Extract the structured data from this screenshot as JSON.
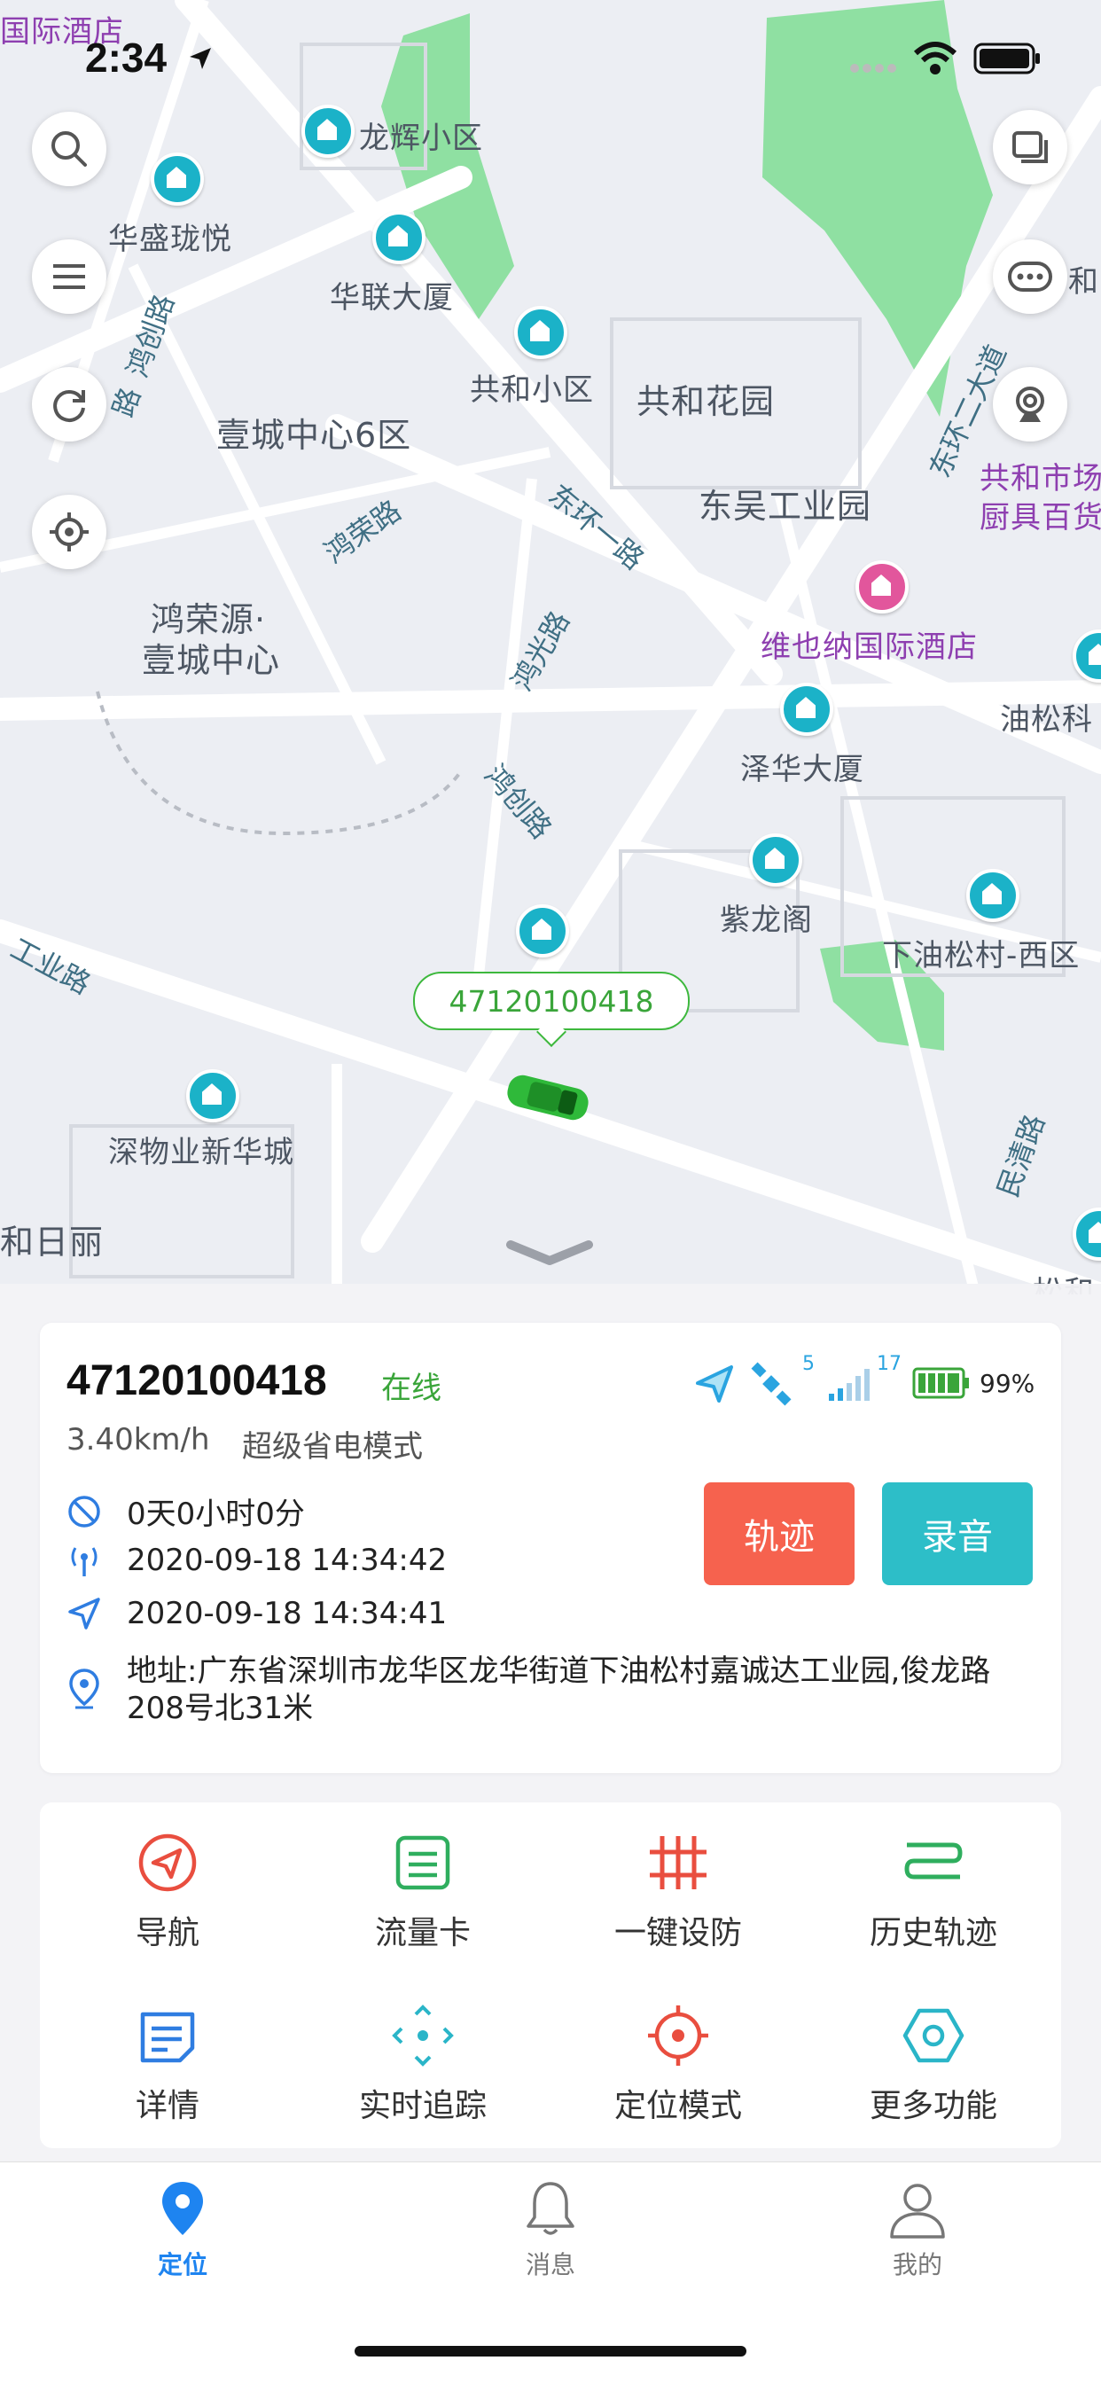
{
  "status_bar": {
    "time": "2:34",
    "battery_icon": "battery-icon",
    "wifi_icon": "wifi-icon"
  },
  "map": {
    "labels": {
      "l1": "国际酒店",
      "l2": "龙辉小区",
      "l3": "华盛珑悦",
      "l4": "华联大厦",
      "l5": "共和小区",
      "l6": "共和花园",
      "l7": "壹城中心6区",
      "l8": "东吴工业园",
      "l9": "鸿荣源·",
      "l10": "壹城中心",
      "l11": "维也纳国际酒店",
      "l12": "泽华大厦",
      "l13": "油松科",
      "l14": "紫龙阁",
      "l15": "下油松村-西区",
      "l16": "深物业新华城",
      "l17": "和日丽",
      "l18": "共和市场",
      "l19": "厨具百货",
      "l20": "和",
      "l21": "松和"
    },
    "roads": {
      "r1": "鸿创路",
      "r2": "路",
      "r3": "东环一路",
      "r4": "鸿荣路",
      "r5": "鸿光路",
      "r6": "鸿创路",
      "r7": "工业路",
      "r8": "东环二大道",
      "r9": "民清路"
    },
    "car_label": "47120100418"
  },
  "device": {
    "id": "47120100418",
    "status": "在线",
    "speed": "3.40km/h",
    "mode": "超级省电模式",
    "gps_sat_count": "5",
    "signal_level": "17",
    "battery": "99%",
    "stop_duration": "0天0小时0分",
    "comm_time": "2020-09-18 14:34:42",
    "locate_time": "2020-09-18 14:34:41",
    "address": "地址:广东省深圳市龙华区龙华街道下油松村嘉诚达工业园,俊龙路208号北31米"
  },
  "buttons": {
    "track": "轨迹",
    "record": "录音"
  },
  "functions": [
    {
      "label": "导航",
      "icon": "navigation-icon",
      "color": "#e94e3f"
    },
    {
      "label": "流量卡",
      "icon": "sim-card-icon",
      "color": "#2fae5e"
    },
    {
      "label": "一键设防",
      "icon": "fortify-icon",
      "color": "#e94e3f"
    },
    {
      "label": "历史轨迹",
      "icon": "history-track-icon",
      "color": "#2fae5e"
    },
    {
      "label": "详情",
      "icon": "details-icon",
      "color": "#2f7de1"
    },
    {
      "label": "实时追踪",
      "icon": "realtime-tracking-icon",
      "color": "#2ab5c8"
    },
    {
      "label": "定位模式",
      "icon": "locate-mode-icon",
      "color": "#e94e3f"
    },
    {
      "label": "更多功能",
      "icon": "more-functions-icon",
      "color": "#2ab5c8"
    }
  ],
  "tabs": [
    {
      "label": "定位",
      "icon": "location-pin-icon",
      "active": true
    },
    {
      "label": "消息",
      "icon": "bell-icon",
      "active": false
    },
    {
      "label": "我的",
      "icon": "user-icon",
      "active": false
    }
  ],
  "colors": {
    "accent_blue": "#1e84f0",
    "online_green": "#3aa53a",
    "track_btn": "#f6624e",
    "record_btn": "#2dbec8"
  }
}
